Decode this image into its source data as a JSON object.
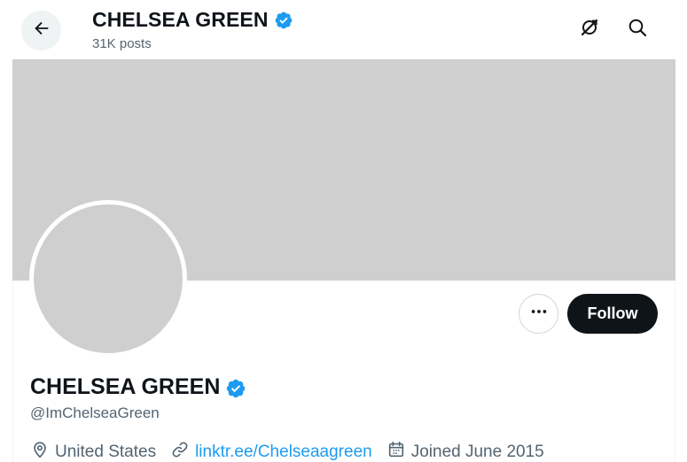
{
  "header": {
    "title": "CHELSEA GREEN",
    "posts": "31K posts",
    "back_icon": "arrow-left-icon",
    "subscribe_icon": "no-notifications-icon",
    "search_icon": "search-icon"
  },
  "profile": {
    "name": "CHELSEA GREEN",
    "handle": "@ImChelseaGreen",
    "verified_color": "#1d9bf0",
    "banner_color": "#cfcfcf",
    "avatar_color": "#cfcfcf",
    "follow_label": "Follow",
    "more_icon": "more-horizontal-icon",
    "location": "United States",
    "website": "linktr.ee/Chelseaagreen",
    "joined": "Joined June 2015"
  },
  "colors": {
    "text_primary": "#0f1419",
    "text_secondary": "#536471",
    "accent": "#1d9bf0",
    "follow_bg": "#0f1419"
  }
}
